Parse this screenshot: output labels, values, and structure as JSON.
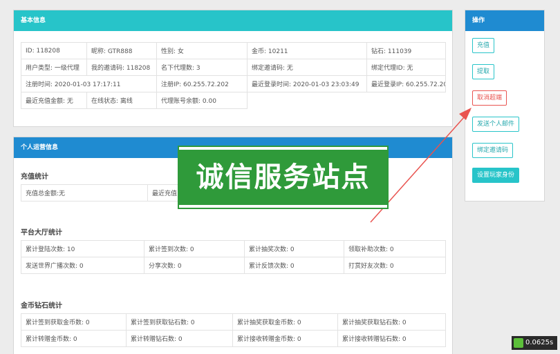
{
  "basic_info": {
    "title": "基本信息",
    "rows": [
      [
        "ID: 118208",
        "昵称: GTR888",
        "性别: 女",
        "金币: 10211",
        "钻石: 111039"
      ],
      [
        "用户类型: 一级代理",
        "我的邀请码: 118208",
        "名下代理数: 3",
        "绑定邀请码: 无",
        "绑定代理ID: 无"
      ],
      [
        "注册时间: 2020-01-03 17:17:11",
        "注册IP: 60.255.72.202",
        "最近登录时间: 2020-01-03 23:03:49",
        "最近登录IP: 60.255.72.202"
      ],
      [
        "最近充值金额: 无",
        "在线状态: 离线",
        "代理账号余额: 0.00"
      ]
    ]
  },
  "personal_ops": {
    "title": "个人运营信息",
    "recharge": {
      "title": "充值统计",
      "row": [
        "充值总金额:无",
        "最近充值"
      ]
    },
    "platform": {
      "title": "平台大厅统计",
      "rows": [
        [
          "累计登陆次数: 10",
          "累计签到次数: 0",
          "累计抽奖次数: 0",
          "领取补助次数: 0"
        ],
        [
          "发送世界广播次数: 0",
          "分享次数: 0",
          "累计反馈次数: 0",
          "打赏好友次数: 0"
        ]
      ]
    },
    "gold": {
      "title": "金币钻石统计",
      "rows": [
        [
          "累计签到获取金币数: 0",
          "累计签到获取钻石数: 0",
          "累计抽奖获取金币数: 0",
          "累计抽奖获取钻石数: 0"
        ],
        [
          "累计转赠金币数: 0",
          "累计转赠钻石数: 0",
          "累计接收转赠金币数: 0",
          "累计接收转赠钻石数: 0"
        ]
      ]
    }
  },
  "operations": {
    "title": "操作",
    "buttons": {
      "recharge": "充值",
      "withdraw": "提取",
      "cancel_super": "取消超端",
      "send_mail": "发送个人邮件",
      "bind_invite": "绑定邀请码",
      "set_identity": "设置玩家身份"
    }
  },
  "watermark": {
    "text": "诚信服务站点"
  },
  "timer": {
    "value": "0.0625s"
  },
  "colors": {
    "teal": "#27c4c9",
    "blue": "#1f8bd1",
    "red": "#e9534f",
    "green": "#2f9a3a"
  }
}
